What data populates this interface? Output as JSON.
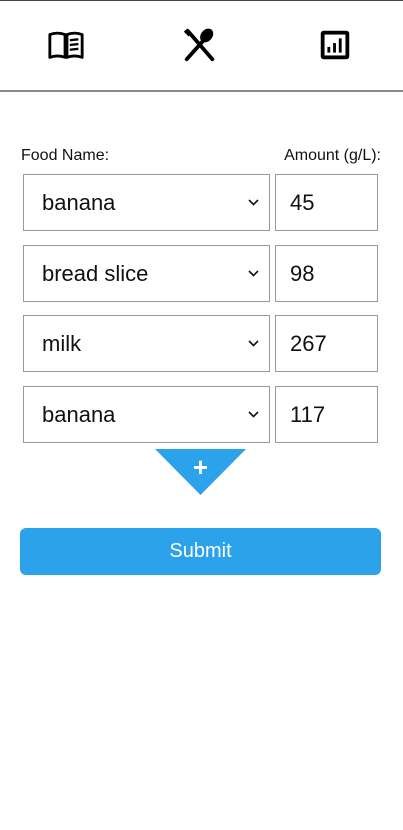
{
  "nav": {
    "items": [
      {
        "icon": "book-icon"
      },
      {
        "icon": "utensils-icon"
      },
      {
        "icon": "chart-icon"
      }
    ]
  },
  "form": {
    "food_name_label": "Food Name:",
    "amount_label": "Amount (g/L):",
    "rows": [
      {
        "food": "banana",
        "amount": "45"
      },
      {
        "food": "bread slice",
        "amount": "98"
      },
      {
        "food": "milk",
        "amount": "267"
      },
      {
        "food": "banana",
        "amount": "117"
      }
    ],
    "add_label": "+",
    "submit_label": "Submit"
  },
  "colors": {
    "accent": "#2ba2ea",
    "border": "#9a9a9a"
  }
}
